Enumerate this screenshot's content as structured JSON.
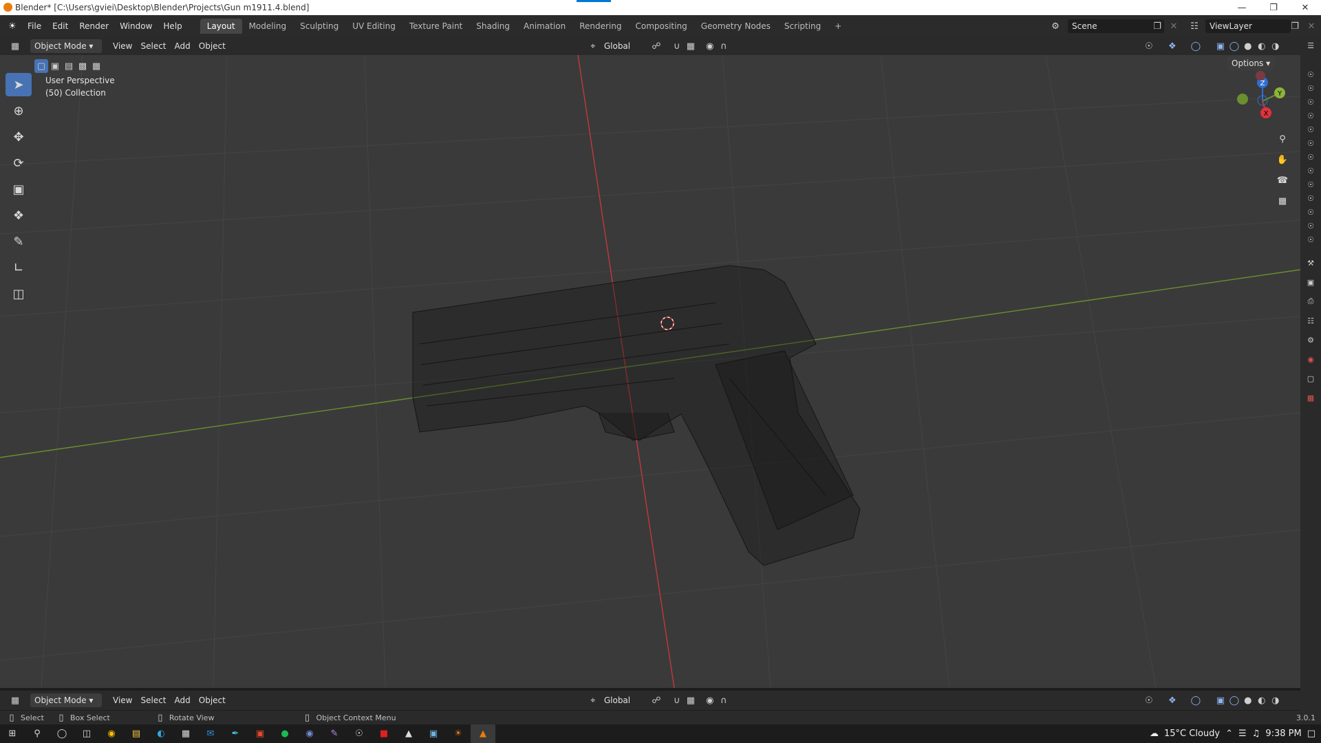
{
  "window": {
    "title": "Blender* [C:\\Users\\gviei\\Desktop\\Blender\\Projects\\Gun m1911.4.blend]"
  },
  "menu": [
    "File",
    "Edit",
    "Render",
    "Window",
    "Help"
  ],
  "workspaces": [
    "Layout",
    "Modeling",
    "Sculpting",
    "UV Editing",
    "Texture Paint",
    "Shading",
    "Animation",
    "Rendering",
    "Compositing",
    "Geometry Nodes",
    "Scripting"
  ],
  "active_workspace": "Layout",
  "scene": {
    "name": "Scene",
    "view_layer": "ViewLayer"
  },
  "header": {
    "mode": "Object Mode",
    "view": "View",
    "select": "Select",
    "add": "Add",
    "object": "Object",
    "orientation": "Global",
    "options": "Options"
  },
  "viewport": {
    "perspective": "User Perspective",
    "collection": "(50) Collection",
    "axis_x": "X",
    "axis_y": "Y",
    "axis_z": "Z"
  },
  "status": {
    "select": "Select",
    "box_select": "Box Select",
    "rotate": "Rotate View",
    "context_menu": "Object Context Menu",
    "version": "3.0.1"
  },
  "taskbar": {
    "weather": "15°C  Cloudy",
    "time": "9:38 PM"
  },
  "colors": {
    "accent": "#4772b3",
    "x_axis": "#c2393c",
    "y_axis": "#6b8f2e",
    "z_axis": "#2f6fd6"
  }
}
